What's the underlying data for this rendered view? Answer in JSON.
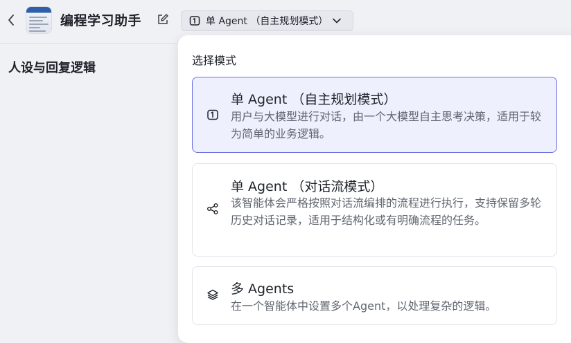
{
  "header": {
    "app_title": "编程学习助手",
    "mode_selector_value": "单 Agent （自主规划模式）"
  },
  "left_panel": {
    "section_title": "人设与回复逻辑"
  },
  "dropdown": {
    "title": "选择模式",
    "options": [
      {
        "icon": "agent-single-icon",
        "title": "单 Agent （自主规划模式）",
        "description": "用户与大模型进行对话，由一个大模型自主思考决策，适用于较为简单的业务逻辑。",
        "selected": true
      },
      {
        "icon": "workflow-icon",
        "title": "单 Agent （对话流模式）",
        "description": "该智能体会严格按照对话流编排的流程进行执行，支持保留多轮历史对话记录，适用于结构化或有明确流程的任务。",
        "selected": false
      },
      {
        "icon": "layers-icon",
        "title": "多 Agents",
        "description": "在一个智能体中设置多个Agent，以处理复杂的逻辑。",
        "selected": false
      }
    ]
  },
  "colors": {
    "selected_border": "#6b6fe0",
    "selected_background": "#eef0fd",
    "page_background": "#f0f1f5"
  }
}
